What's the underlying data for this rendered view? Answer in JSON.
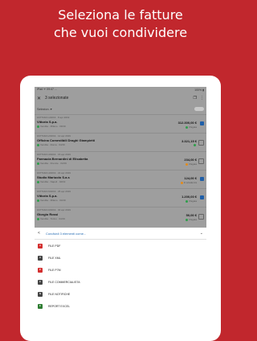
{
  "headline": {
    "line1": "Seleziona le fatture",
    "line2": "che vuoi condividere"
  },
  "colors": {
    "brand": "#c1272d",
    "accent": "#1f5fa8",
    "status_green": "#2e9e4a",
    "status_orange": "#e38b1b",
    "pdf_red": "#d32f2f"
  },
  "statusbar": {
    "left": "iPad ᯤ  09:47 ...",
    "right": "100% ▮"
  },
  "topbar": {
    "title": "3 selezionate",
    "back_icon": "close-icon",
    "actions": [
      "copy-icon",
      "more-icon"
    ]
  },
  "filter": {
    "label": "Selezion. ▾"
  },
  "invoices": [
    {
      "meta": "FATTURA 1/2019 · 8 apr 2019",
      "name": "Vittoria S.p.a.",
      "sub": "Vendita · Milano · 09/19",
      "amount": "312.300,00 €",
      "status": "Pagata",
      "status_color": "#2e9e4a",
      "checked": true
    },
    {
      "meta": "FATTURA 2/2019 · 12 apr 2019",
      "name": "Officina Comestibili Draghi Giampietti",
      "sub": "Vendita · Roma · 04/19",
      "amount": "3.321,15 €",
      "status": "",
      "status_color": "#2e9e4a",
      "checked": false
    },
    {
      "meta": "FATTURA 3/2019 · 15 apr 2019",
      "name": "Farmacia Bernardini di Elisabetta",
      "sub": "Vendita · Firenze · 04/19",
      "amount": "234,00 €",
      "status": "Pagata",
      "status_color": "#e38b1b",
      "checked": false
    },
    {
      "meta": "FATTURA 4/2019 · 22 apr 2019",
      "name": "Studio Mariuolo S.a.s",
      "sub": "Vendita · Napoli · 04/19",
      "amount": "124,00 €",
      "status": "In scadenza",
      "status_color": "#e38b1b",
      "checked": true
    },
    {
      "meta": "FATTURA 5/2019 · 25 apr 2019",
      "name": "Vittoria S.p.a.",
      "sub": "Vendita · Milano · 04/19",
      "amount": "1.200,00 €",
      "status": "Pagata",
      "status_color": "#2e9e4a",
      "checked": true
    },
    {
      "meta": "FATTURA 6/2019 · 30 apr 2019",
      "name": "Giorgio Rossi",
      "sub": "Vendita · Torino · 04/19",
      "amount": "50,00 €",
      "status": "Pagata",
      "status_color": "#2e9e4a",
      "checked": false
    }
  ],
  "share": {
    "title": "Condividi 3 elementi come...",
    "options": [
      {
        "label": "FILE PDF",
        "icon": "pdf-icon",
        "color": "#d32f2f",
        "glyph": "A"
      },
      {
        "label": "FILE XML",
        "icon": "xml-icon",
        "color": "#444444",
        "glyph": "X"
      },
      {
        "label": "FILE P7M",
        "icon": "p7m-icon",
        "color": "#d32f2f",
        "glyph": "P"
      },
      {
        "label": "FILE COMMERCIALISTA",
        "icon": "accountant-icon",
        "color": "#444444",
        "glyph": "C"
      },
      {
        "label": "FILE NOTIFICHE",
        "icon": "bell-icon",
        "color": "#444444",
        "glyph": "N"
      },
      {
        "label": "REPORT EXCEL",
        "icon": "excel-icon",
        "color": "#2e7d32",
        "glyph": "E"
      }
    ]
  }
}
